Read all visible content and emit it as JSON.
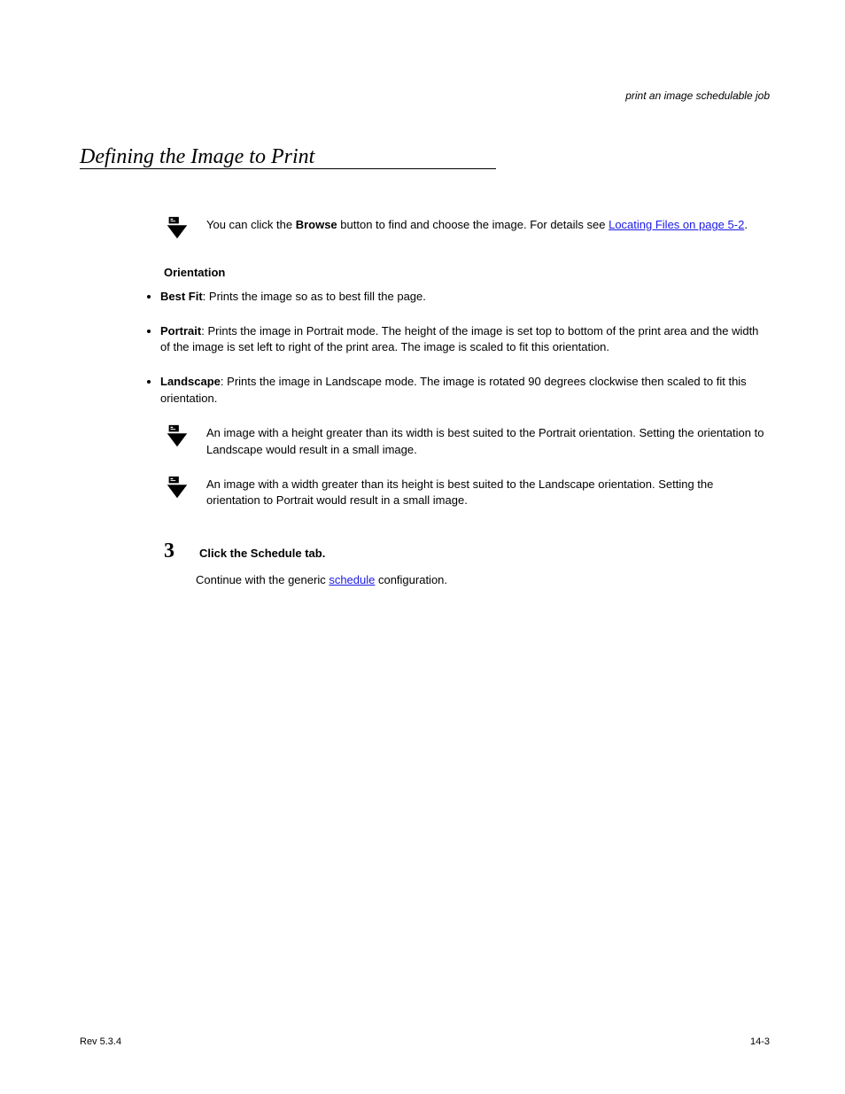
{
  "header": {
    "running_head": "print an image schedulable job"
  },
  "section": {
    "title": "Defining the Image to Print"
  },
  "body": {
    "note1_pre": "You can click the ",
    "note1_btn": "Browse",
    "note1_post": " button to find and choose the image. For details see ",
    "note1_link": "Locating Files on page 5-2",
    "note1_period": ".",
    "orientation_label": "Orientation",
    "options": [
      {
        "name": "Best Fit",
        "desc": "Prints the image so as to best fill the page."
      },
      {
        "name": "Portrait",
        "desc": "Prints the image in Portrait mode. The height of the image is set top to bottom of the print area and the width of the image is set left to right of the print area. The image is scaled to fit this orientation."
      },
      {
        "name": "Landscape",
        "desc": "Prints the image in Landscape mode. The image is rotated 90 degrees clockwise then scaled to fit this orientation."
      }
    ],
    "note2": "An image with a height greater than its width is best suited to the Portrait orientation. Setting the orientation to Landscape would result in a small image.",
    "note3": "An image with a width greater than its height is best suited to the Landscape orientation. Setting the orientation to Portrait would result in a small image."
  },
  "step3": {
    "num": "3",
    "title_pre": "Click the ",
    "title_tab": "Schedule",
    "title_post": " tab.",
    "body_pre": "Continue with the generic ",
    "body_link": "schedule",
    "body_post": " configuration."
  },
  "footer": {
    "left": "Rev 5.3.4",
    "right": "14-3"
  }
}
